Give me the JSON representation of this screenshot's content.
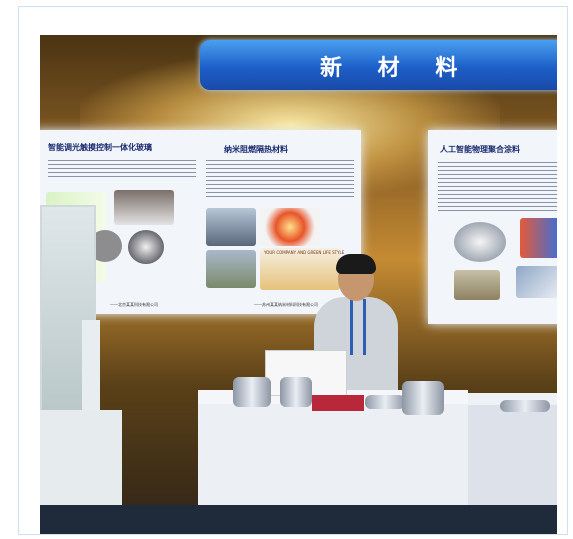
{
  "banner": {
    "title": "新 材 料"
  },
  "panel_left": {
    "heading_left": "智能调光触摸控制一体化玻璃",
    "heading_right": "纳米阻燃隔热材料",
    "footer_left": "——北京某某科技有限公司",
    "footer_right": "——苏州某某纳米材料科技有限公司",
    "sign_text": "YOUR COMPANY AND GREEN LIFE STYLE"
  },
  "panel_right": {
    "heading": "人工智能物理聚合涂料"
  },
  "colors": {
    "banner": "#1d5fc8",
    "panel": "#f2f6fb",
    "heading": "#1b2a6e",
    "tablecloth": "#b8283a"
  }
}
